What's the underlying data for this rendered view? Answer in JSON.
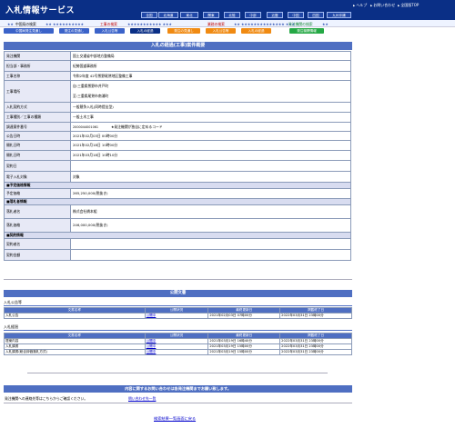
{
  "header": {
    "title": "入札情報サービス",
    "links": [
      "ヘルプ",
      "お問い合わせ",
      "全国版TOP"
    ],
    "regions": [
      "全国",
      "北海道",
      "東北",
      "関東",
      "北陸",
      "中部",
      "近畿",
      "中国",
      "四国",
      "九州沖縄"
    ]
  },
  "subnav": {
    "stars1": "★★",
    "current": "中国局の検索",
    "stars2": "★★ ★★★★★★★★★★",
    "item_search": "工事の検索",
    "stars3": "★★★★★★★★★★★ ★★★",
    "result_search": "業務の検索",
    "stars4": "★★ ★★★★★★★★★★★★★★ ★★★",
    "org_search": "発注機関の検索",
    "stars5": "★★"
  },
  "tabs": [
    "中国局発注見通し",
    "発注の見通し",
    "入札公告等",
    "入札の経過",
    "発注の見通し",
    "入札公告等",
    "入札の経過",
    "発注機関情報"
  ],
  "overview": {
    "title": "入札の経過(工事)案件概要",
    "rows": [
      {
        "label": "発注機関",
        "value": "国土交通省中部地方整備局"
      },
      {
        "label": "担当部・事務所",
        "value": "紀勢国道事務所"
      },
      {
        "label": "工事名称",
        "value": "令和2年度 42号熊野尾鷲地区整備工事"
      },
      {
        "label": "工事場所",
        "value": "自:三重県熊野市井戸町",
        "value2": "至:三重県尾鷲市南浦町"
      },
      {
        "label": "入札契約方式",
        "value": "一般競争入札(同時提出型)"
      },
      {
        "label": "工事種別／工事の種類",
        "value": "一般土木工事"
      },
      {
        "label": "調達案件番号",
        "value": "2000044001061",
        "note": "★発注機関が独自に定めるコード"
      },
      {
        "label": "公告日時",
        "value": "2021年02月03日 00時00分"
      },
      {
        "label": "開札日時",
        "value": "2021年02月18日 10時00分"
      },
      {
        "label": "開札日時",
        "value": "2021年03月18日 10時10分"
      },
      {
        "label": "契約日",
        "value": ""
      },
      {
        "label": "電子入札対象",
        "value": "対象"
      }
    ],
    "section_estimate": "■予定価格情報",
    "estimate_row": {
      "label": "予定価格",
      "value": "265,250,000(税抜き)"
    },
    "section_winner": "■落札者情報",
    "winner_rows": [
      {
        "label": "落札者名",
        "value": "株式会社橋本組"
      },
      {
        "label": "落札価格",
        "value": "246,000,000(税抜き)"
      }
    ],
    "section_contract": "■契約情報",
    "contract_rows": [
      {
        "label": "契約者名",
        "value": ""
      },
      {
        "label": "契約金額",
        "value": ""
      }
    ]
  },
  "documents": {
    "title": "公開文書",
    "bid_notice": {
      "heading": "入札公告等",
      "columns": [
        "文書名称",
        "公開状況",
        "最終更新日",
        "掲載終了日"
      ],
      "rows": [
        {
          "name": "入札公告",
          "status": "公開中",
          "updated": "2021年02月03日 07時00分",
          "end": "2022年03月31日 23時00分"
        }
      ]
    },
    "bid_progress": {
      "heading": "入札経過",
      "columns": [
        "文書名称",
        "公開状況",
        "最終更新日",
        "掲載終了日"
      ],
      "rows": [
        {
          "name": "提案内容",
          "status": "公開中",
          "updated": "2021年03月19日 16時40分",
          "end": "2022年03月31日 23時00分"
        },
        {
          "name": "入札調書",
          "status": "公開中",
          "updated": "2021年03月19日 15時00分",
          "end": "2022年03月31日 23時00分"
        },
        {
          "name": "入札調書(総合評価落札方式)",
          "status": "公開中",
          "updated": "2021年03月19日 15時00分",
          "end": "2022年03月31日 23時00分"
        }
      ]
    }
  },
  "contact": {
    "banner": "内容に関するお問い合わせは各発注機関までお願い致します。",
    "text": "発注機関への連絡先等はこちらからご確認ください。",
    "link": "問い合わせ先一覧"
  },
  "footer": {
    "back_link": "検索結果一覧画面に戻る"
  },
  "colors": {
    "header_bg": "#0a2f86",
    "bar": "#4f6fc2",
    "tab_blue": "#3b63c9",
    "tab_orange": "#f08a12",
    "tab_green": "#25a845",
    "tab_active": "#0a2f86"
  }
}
